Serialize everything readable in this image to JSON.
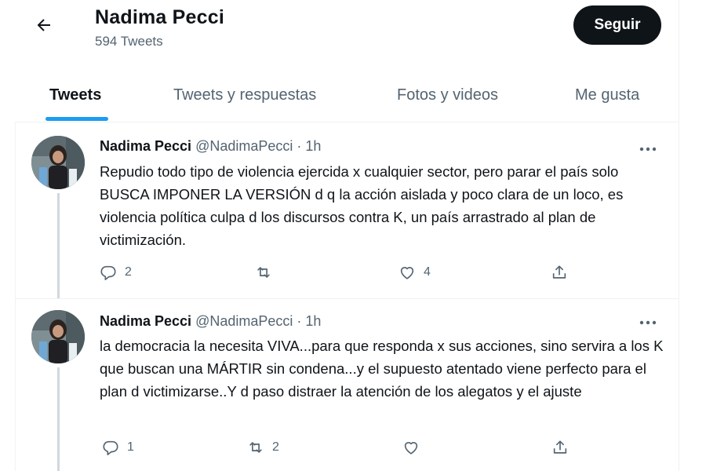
{
  "header": {
    "title": "Nadima Pecci",
    "tweet_count": "594 Tweets",
    "follow_label": "Seguir"
  },
  "tabs": [
    {
      "label": "Tweets",
      "active": true
    },
    {
      "label": "Tweets y respuestas",
      "active": false
    },
    {
      "label": "Fotos y videos",
      "active": false
    },
    {
      "label": "Me gusta",
      "active": false
    }
  ],
  "tweets": [
    {
      "name": "Nadima Pecci",
      "handle": "@NadimaPecci",
      "separator": "·",
      "time": "1h",
      "text": "Repudio todo tipo de violencia ejercida x cualquier sector, pero parar el país solo BUSCA IMPONER LA VERSIÓN d q la acción aislada y poco clara de un loco, es violencia política culpa d los discursos contra K, un país arrastrado al plan de victimización.",
      "replies": "2",
      "retweets": "",
      "likes": "4"
    },
    {
      "name": "Nadima Pecci",
      "handle": "@NadimaPecci",
      "separator": "·",
      "time": "1h",
      "text": "la democracia la necesita  VIVA...para que responda x sus acciones, sino servira a los K que buscan una MÁRTIR sin condena...y el supuesto atentado  viene perfecto para el plan d victimizarse..Y d paso distraer la atención de los alegatos y el ajuste",
      "replies": "1",
      "retweets": "2",
      "likes": ""
    }
  ],
  "icons": {
    "back": "arrow-left-icon",
    "more": "more-horizontal-icon",
    "reply": "reply-icon",
    "retweet": "retweet-icon",
    "like": "heart-icon",
    "share": "share-icon"
  },
  "colors": {
    "accent": "#1d9bf0",
    "text": "#0f1419",
    "secondary": "#536471",
    "follow_bg": "#0f1419"
  }
}
